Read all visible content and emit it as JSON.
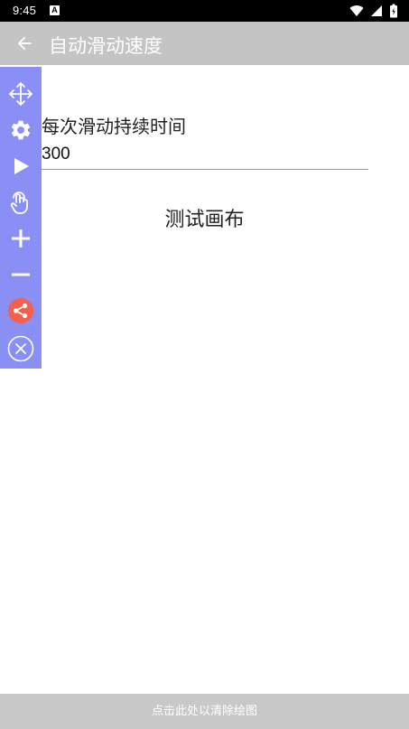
{
  "status_bar": {
    "time": "9:45",
    "notification_glyph": "A",
    "icons": [
      "wifi-icon",
      "cell-signal-icon",
      "battery-icon"
    ]
  },
  "app_bar": {
    "back_icon": "arrow-back-icon",
    "title": "自动滑动速度"
  },
  "form": {
    "label": "每次滑动持续时间",
    "value": "300"
  },
  "canvas": {
    "label": "测试画布"
  },
  "toolbar": {
    "background_color": "#8a8ff5",
    "tools": [
      "move-icon",
      "settings-icon",
      "play-icon",
      "touch-icon",
      "plus-icon",
      "minus-icon",
      "share-icon",
      "close-icon"
    ],
    "share_color": "#f4604a"
  },
  "bottom_bar": {
    "label": "点击此处以清除绘图"
  }
}
